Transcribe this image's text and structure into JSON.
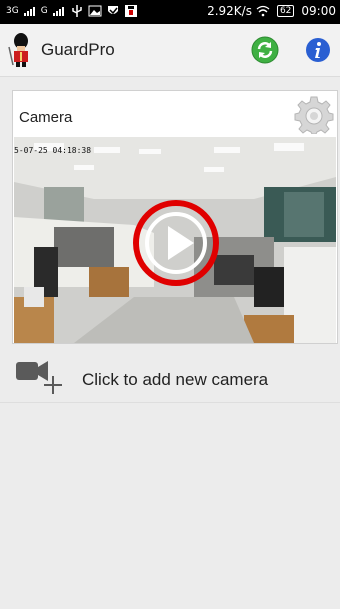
{
  "status_bar": {
    "network_left": "3G",
    "network_right": "G",
    "speed": "2.92K/s",
    "battery": "62",
    "time": "09:00"
  },
  "app_bar": {
    "title": "GuardPro",
    "refresh_icon": "refresh-icon",
    "info_icon": "info-icon",
    "accent_green": "#3fb043",
    "accent_blue": "#2a5fd2"
  },
  "camera_card": {
    "title": "Camera",
    "timestamp": "5-07-25 04:18:38",
    "settings_icon": "gear-icon",
    "play_icon": "play-icon",
    "play_ring_color": "#e00000"
  },
  "add_camera": {
    "label": "Click to add new camera",
    "icon": "add-camera-icon"
  }
}
